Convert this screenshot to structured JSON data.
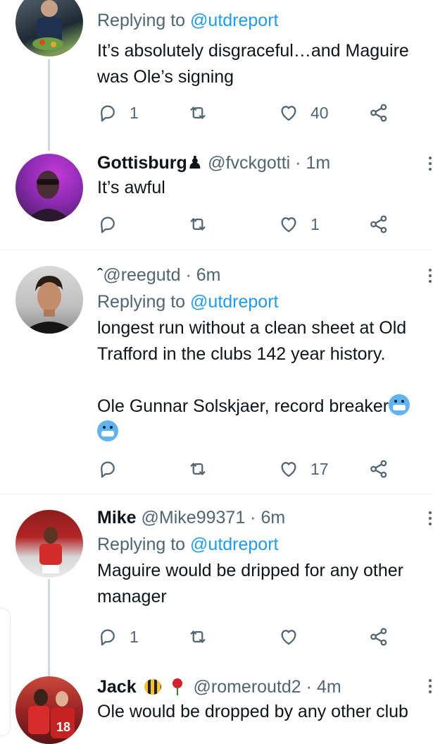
{
  "tweets": [
    {
      "replying_prefix": "Replying to",
      "replying_handle": "@utdreport",
      "lines": [
        "It’s absolutely disgraceful…and Maguire",
        "was Ole’s signing"
      ],
      "reply_count": "1",
      "retweet_count": "",
      "like_count": "40"
    },
    {
      "name": "Gottisburg",
      "name_icon": "♟",
      "handle": "@fvckgotti",
      "time": "1m",
      "lines": [
        "It’s awful"
      ],
      "reply_count": "",
      "retweet_count": "",
      "like_count": "1"
    },
    {
      "name_icon": "ˆ",
      "handle": "@reegutd",
      "time": "6m",
      "replying_prefix": "Replying to",
      "replying_handle": "@utdreport",
      "lines": [
        "longest run without a clean sheet at Old",
        "Trafford in the clubs 142 year history.",
        "",
        "Ole Gunnar Solskjaer, record breaker"
      ],
      "emoji": "cold-face-emoji",
      "reply_count": "",
      "retweet_count": "",
      "like_count": "17"
    },
    {
      "name": "Mike",
      "handle": "@Mike99371",
      "time": "6m",
      "replying_prefix": "Replying to",
      "replying_handle": "@utdreport",
      "lines": [
        "Maguire would be dripped for any other",
        "manager"
      ],
      "reply_count": "1",
      "retweet_count": "",
      "like_count": ""
    },
    {
      "name": "Jack",
      "name_emojis": [
        "bee-emoji",
        "rose-emoji"
      ],
      "handle": "@romeroutd2",
      "time": "4m",
      "lines": [
        "Ole would be dropped by any other club"
      ]
    }
  ],
  "separator": " · ",
  "colors": {
    "text": "#0f1419",
    "secondary": "#536471",
    "link": "#1d9bf0",
    "divider": "#eff3f4",
    "thread": "#cfd9de"
  },
  "icons": [
    "reply-icon",
    "retweet-icon",
    "like-icon",
    "share-icon",
    "more-icon"
  ]
}
